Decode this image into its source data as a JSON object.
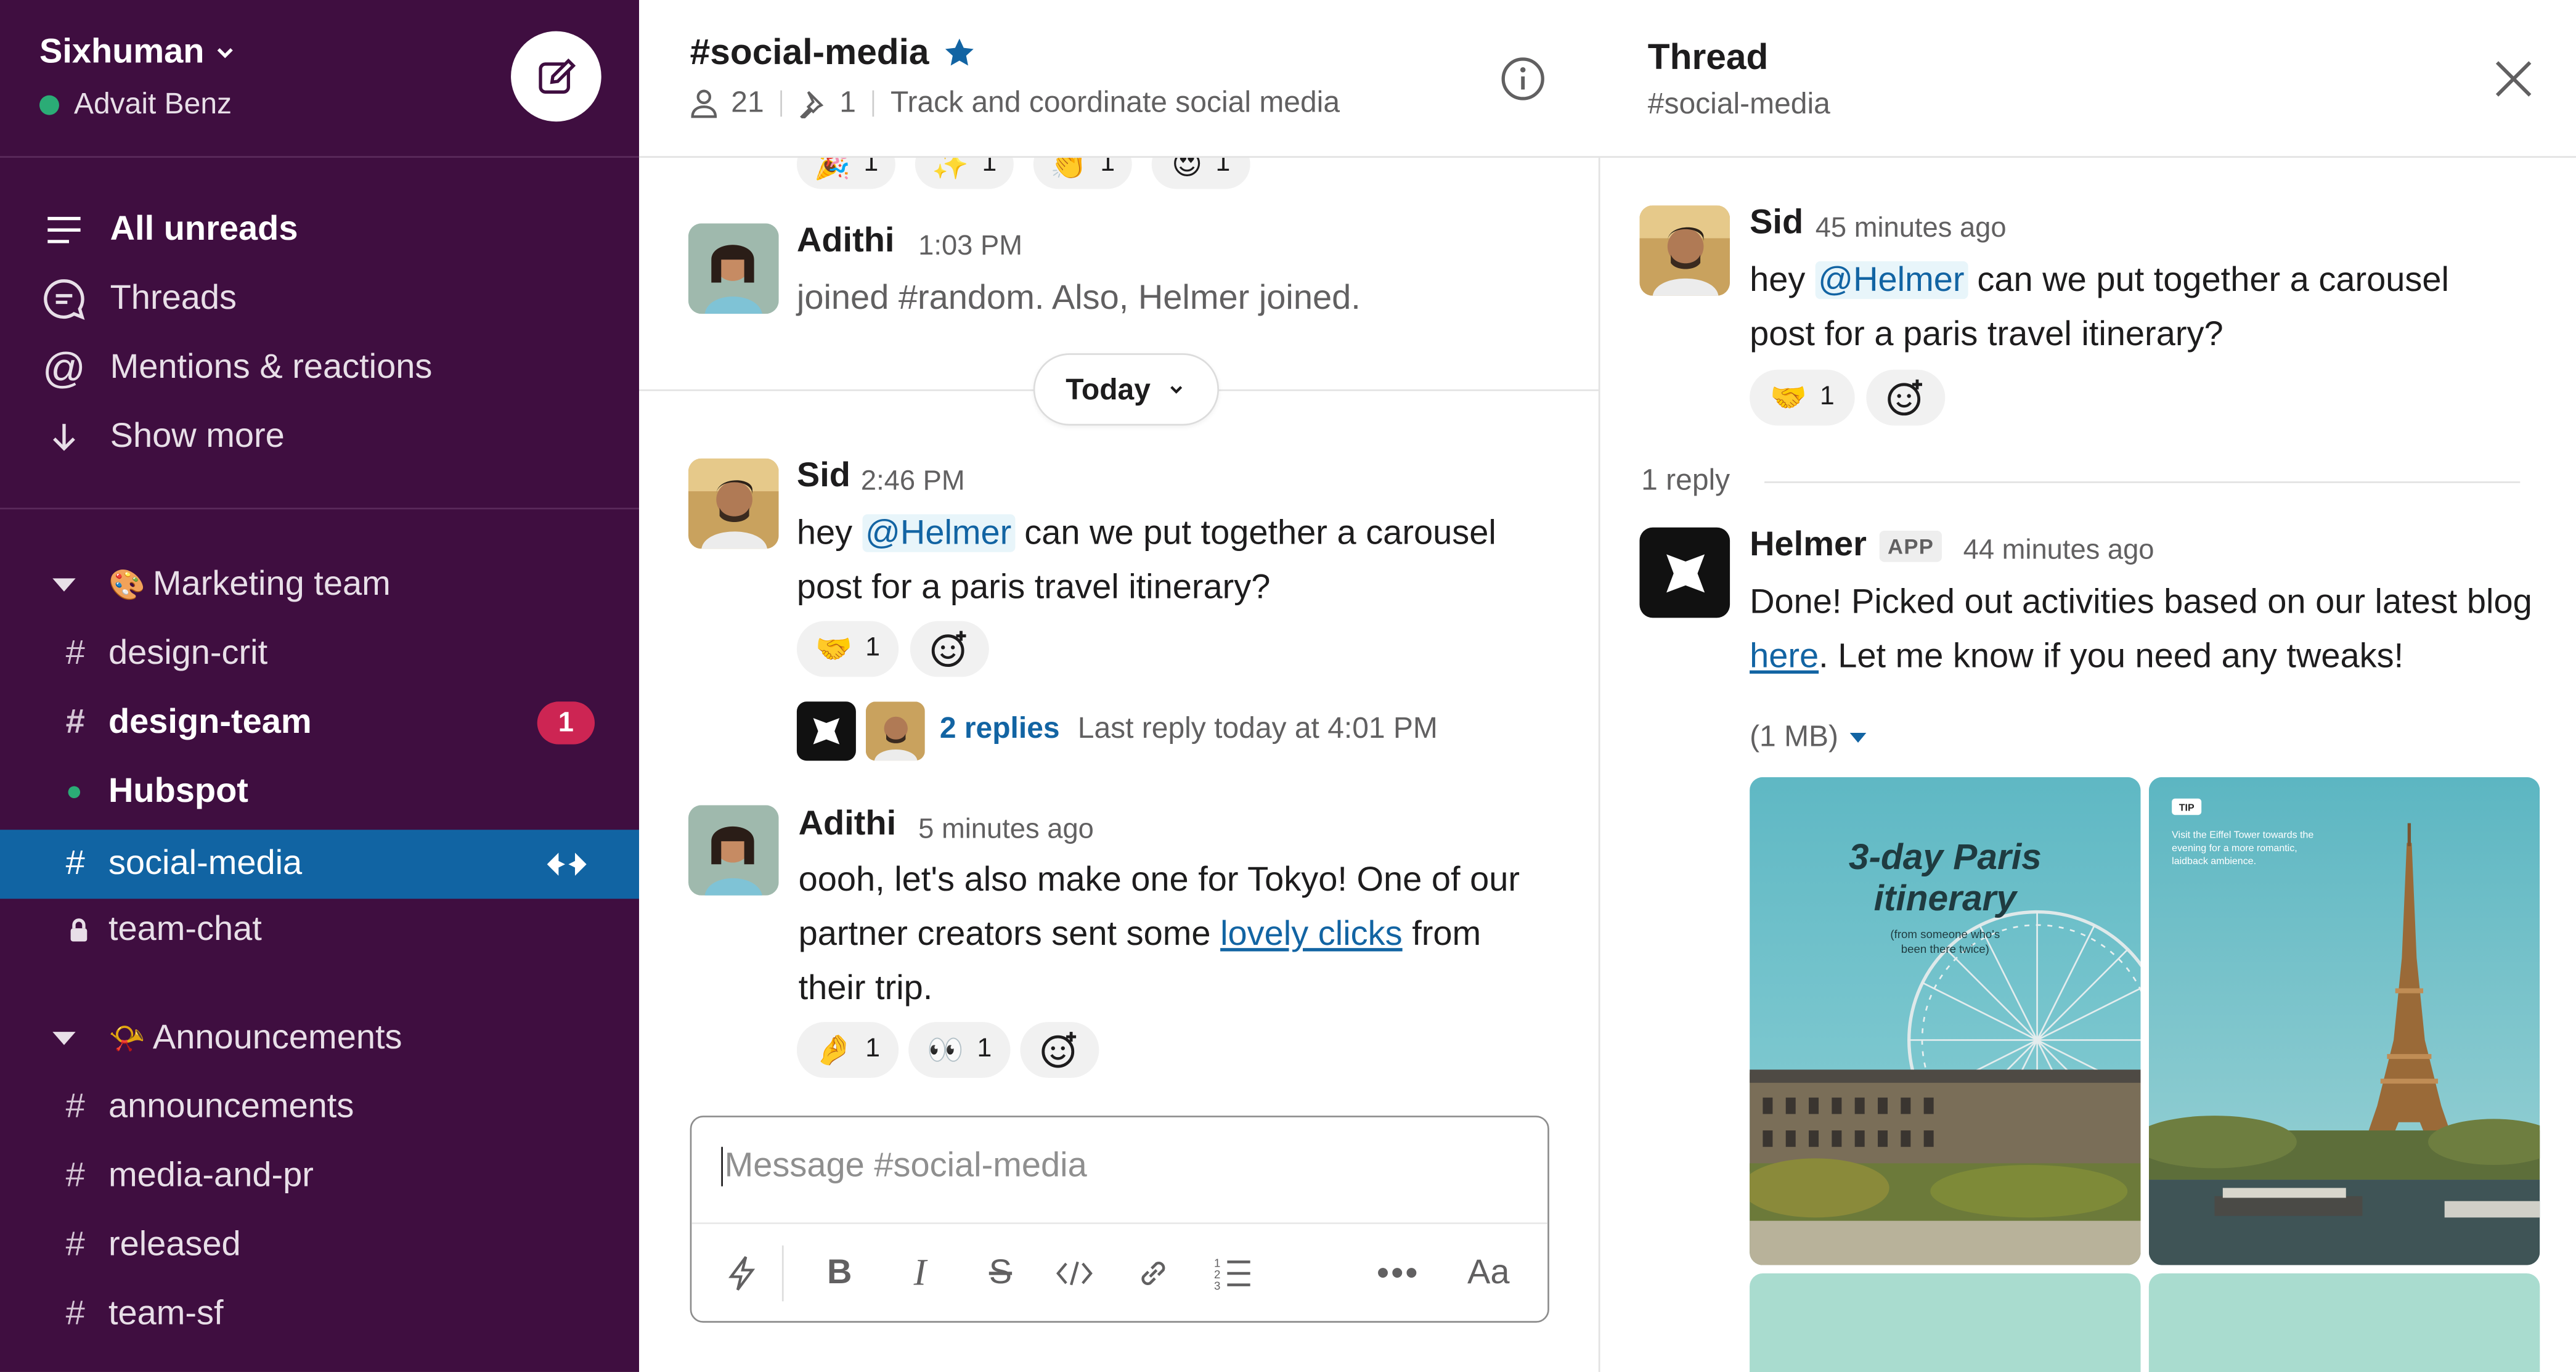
{
  "workspace": {
    "name": "Sixhuman",
    "user": "Advait Benz"
  },
  "nav": [
    {
      "label": "All unreads",
      "icon": "all-unreads-icon"
    },
    {
      "label": "Threads",
      "icon": "threads-icon"
    },
    {
      "label": "Mentions & reactions",
      "icon": "mentions-icon"
    },
    {
      "label": "Show more",
      "icon": "arrow-down-icon"
    }
  ],
  "sections": [
    {
      "emoji": "🎨",
      "label": "Marketing team",
      "channels": [
        {
          "prefix": "#",
          "label": "design-crit"
        },
        {
          "prefix": "#",
          "label": "design-team",
          "badge": "1"
        },
        {
          "prefix": "●",
          "label": "Hubspot"
        },
        {
          "prefix": "#",
          "label": "social-media"
        },
        {
          "prefix": "🔒",
          "label": "team-chat"
        }
      ]
    },
    {
      "emoji": "📯",
      "label": "Announcements",
      "channels": [
        {
          "prefix": "#",
          "label": "announcements"
        },
        {
          "prefix": "#",
          "label": "media-and-pr"
        },
        {
          "prefix": "#",
          "label": "released"
        },
        {
          "prefix": "#",
          "label": "team-sf"
        }
      ]
    }
  ],
  "channel": {
    "title": "#social-media",
    "members": "21",
    "pins": "1",
    "topic": "Track and coordinate social media"
  },
  "top_reactions": [
    {
      "emoji": "🎉",
      "count": "1"
    },
    {
      "emoji": "✨",
      "count": "1"
    },
    {
      "emoji": "👏",
      "count": "1"
    },
    {
      "emoji": "😍",
      "count": "1"
    }
  ],
  "messages": [
    {
      "name": "Adithi",
      "time": "1:03 PM",
      "text": "joined #random. Also, Helmer joined."
    },
    {
      "name": "Sid",
      "time": "2:46 PM",
      "text_before": "hey ",
      "mention": "@Helmer",
      "text_after": " can we put together a carousel post for a paris travel itinerary?",
      "reactions": [
        {
          "emoji": "🤝",
          "count": "1"
        }
      ],
      "replies": "2 replies",
      "last_reply": "Last reply today at 4:01 PM"
    },
    {
      "name": "Adithi",
      "time": "5 minutes ago",
      "text_before": "oooh, let's also make one for Tokyo! One of our partner creators sent some ",
      "link": "lovely clicks",
      "text_after": " from their trip.",
      "reactions": [
        {
          "emoji": "🤌",
          "count": "1"
        },
        {
          "emoji": "👀",
          "count": "1"
        }
      ]
    }
  ],
  "divider": {
    "label": "Today"
  },
  "composer": {
    "placeholder": "Message #social-media",
    "format_label": "Aa"
  },
  "thread": {
    "title": "Thread",
    "subtitle": "#social-media",
    "parent": {
      "name": "Sid",
      "time": "45 minutes ago",
      "text_before": "hey ",
      "mention": "@Helmer",
      "text_after": " can we put together a carousel post for a paris travel itinerary?",
      "reactions": [
        {
          "emoji": "🤝",
          "count": "1"
        }
      ]
    },
    "reply_count": "1 reply",
    "reply": {
      "name": "Helmer",
      "tag": "APP",
      "time": "44 minutes ago",
      "text_before": "Done! Picked out activities based on our latest blog ",
      "link": "here",
      "text_after": ". Let me know if you need any tweaks!",
      "file_size": "(1 MB)"
    },
    "cards": [
      {
        "title_line1": "3-day Paris",
        "title_line2": "itinerary",
        "caption_line1": "(from someone who's",
        "caption_line2": "been there twice)"
      },
      {
        "tip": "TIP",
        "tip_line1": "Visit the Eiffel Tower towards the",
        "tip_line2": "evening for a more romantic,",
        "tip_line3": "laidback ambience."
      }
    ]
  },
  "colors": {
    "sidebar": "#3f0e40",
    "active": "#1164a3",
    "badge": "#cd2553",
    "link": "#1264a3",
    "presence": "#2bac76"
  }
}
